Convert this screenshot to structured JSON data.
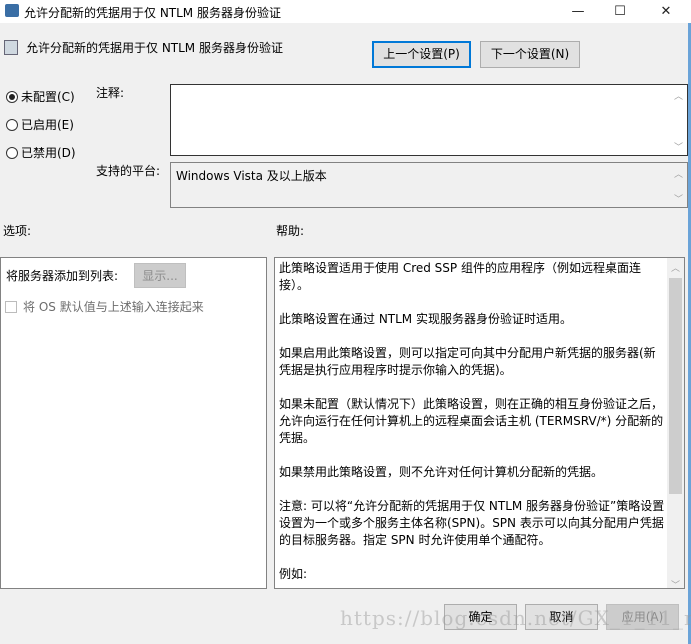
{
  "window": {
    "title": "允许分配新的凭据用于仅 NTLM 服务器身份验证",
    "minimize": "—",
    "maximize": "☐",
    "close": "✕"
  },
  "header": {
    "policy_title": "允许分配新的凭据用于仅 NTLM 服务器身份验证",
    "prev_button": "上一个设置(P)",
    "next_button": "下一个设置(N)"
  },
  "state": {
    "options": [
      {
        "label": "未配置(C)",
        "checked": true
      },
      {
        "label": "已启用(E)",
        "checked": false
      },
      {
        "label": "已禁用(D)",
        "checked": false
      }
    ]
  },
  "comment": {
    "label": "注释:",
    "value": ""
  },
  "platform": {
    "label": "支持的平台:",
    "value": "Windows Vista 及以上版本"
  },
  "options_panel": {
    "heading": "选项:",
    "add_servers_label": "将服务器添加到列表:",
    "show_button": "显示...",
    "concat_checkbox": "将 OS 默认值与上述输入连接起来"
  },
  "help_panel": {
    "heading": "帮助:",
    "paragraphs": [
      "此策略设置适用于使用 Cred SSP 组件的应用程序（例如远程桌面连接）。",
      "此策略设置在通过 NTLM 实现服务器身份验证时适用。",
      "如果启用此策略设置，则可以指定可向其中分配用户新凭据的服务器(新凭据是执行应用程序时提示你输入的凭据)。",
      "如果未配置（默认情况下）此策略设置，则在正确的相互身份验证之后，允许向运行在任何计算机上的远程桌面会话主机 (TERMSRV/*) 分配新的凭据。",
      "如果禁用此策略设置，则不允许对任何计算机分配新的凭据。",
      "注意: 可以将“允许分配新的凭据用于仅 NTLM 服务器身份验证”策略设置设置为一个或多个服务主体名称(SPN)。SPN 表示可以向其分配用户凭据的目标服务器。指定 SPN 时允许使用单个通配符。",
      "例如:"
    ]
  },
  "footer": {
    "ok": "确定",
    "cancel": "取消",
    "apply": "应用(A)"
  },
  "watermark": "https://blog.csdn.net/GX_1_11_real"
}
